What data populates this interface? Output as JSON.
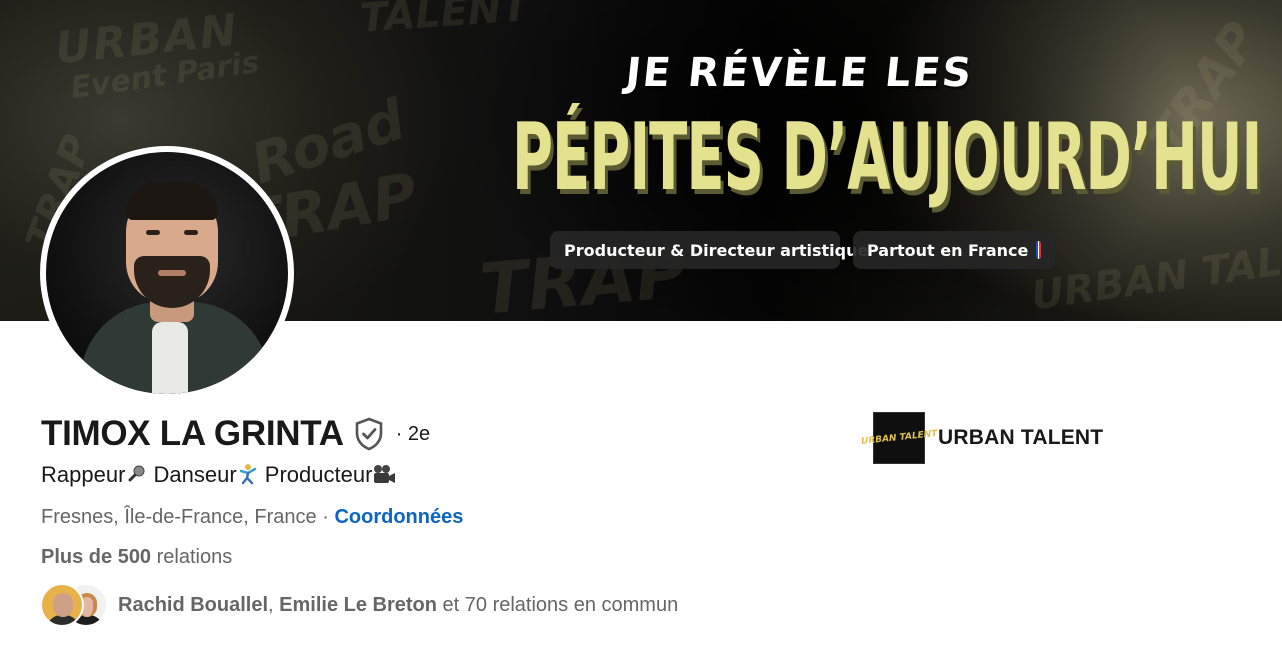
{
  "banner": {
    "headline_top": "JE RÉVÈLE LES",
    "headline_main": "PÉPITES D’AUJOURD’HUI",
    "pills": [
      {
        "label": "Producteur & Directeur artistique"
      },
      {
        "label": "Partout en France",
        "icon": "france-flag-icon"
      }
    ],
    "watermarks": [
      "URBAN",
      "Event Paris",
      "Road",
      "TRAP",
      "TALENT",
      "TRAP",
      "URBAN TALENT",
      "TRAP",
      "TRAP"
    ],
    "colors": {
      "headline_main": "#e4e28f",
      "headline_top": "#ffffff",
      "pill_bg": "#262626"
    }
  },
  "profile": {
    "name": "TIMOX LA GRINTA",
    "verified_icon": "verified-shield-icon",
    "degree": "· 2e",
    "headline_parts": [
      {
        "text": "Rappeur",
        "icon": "microphone-emoji-icon"
      },
      {
        "text": " Danseur",
        "icon": "dancer-emoji-icon"
      },
      {
        "text": " Producteur",
        "icon": "movie-camera-emoji-icon"
      }
    ],
    "location": "Fresnes, Île-de-France, France",
    "separator": " · ",
    "contact_link": "Coordonnées",
    "connections_bold": "Plus de 500",
    "connections_rest": " relations",
    "mutual": {
      "name1": "Rachid Bouallel",
      "comma": ", ",
      "name2": "Emilie Le Breton",
      "rest": " et 70 relations en commun"
    }
  },
  "company": {
    "name": "URBAN TALENT",
    "logo_text": "URBAN TALENT"
  },
  "colors": {
    "link": "#0a66c2",
    "muted_text": "#666666",
    "primary_text": "#191919"
  }
}
